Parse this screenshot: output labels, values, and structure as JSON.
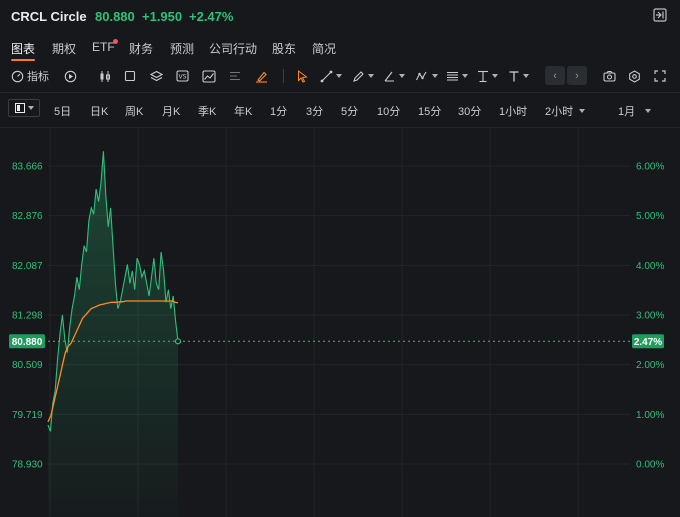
{
  "header": {
    "symbol": "CRCL Circle",
    "price": "80.880",
    "change": "+1.950",
    "change_pct": "+2.47%",
    "up_color": "#2fc07a",
    "exit_icon": "exit-fullscreen-icon"
  },
  "nav": {
    "tabs": [
      {
        "label": "图表",
        "active": true
      },
      {
        "label": "期权"
      },
      {
        "label": "ETF",
        "badge": true
      },
      {
        "label": "财务"
      },
      {
        "label": "预测"
      },
      {
        "label": "公司行动"
      },
      {
        "label": "股东"
      },
      {
        "label": "简况"
      }
    ],
    "accent": "#ff7a1a"
  },
  "toolbar": {
    "indicators_label": "指标"
  },
  "periods": {
    "items": [
      "5日",
      "日K",
      "周K",
      "月K",
      "季K",
      "年K",
      "1分",
      "3分",
      "5分",
      "10分",
      "15分",
      "30分",
      "1小时",
      "2小时",
      "1月"
    ],
    "dropdown_items": [
      "2小时",
      "1月"
    ]
  },
  "chart_data": {
    "type": "line",
    "y_left_ticks": [
      "83.666",
      "82.876",
      "82.087",
      "81.298",
      "80.509",
      "79.719",
      "78.930"
    ],
    "y_right_ticks": [
      "6.00%",
      "5.00%",
      "4.00%",
      "3.00%",
      "2.00%",
      "1.00%",
      "0.00%"
    ],
    "ylim": [
      78.93,
      83.666
    ],
    "current_price_label": "80.880",
    "current_pct_label": "2.47%",
    "price_series": [
      79.55,
      79.45,
      79.9,
      80.1,
      80.6,
      81.0,
      81.3,
      80.9,
      80.7,
      81.1,
      81.4,
      81.6,
      81.9,
      81.7,
      82.1,
      82.4,
      82.3,
      82.8,
      83.0,
      82.9,
      83.3,
      83.1,
      83.4,
      83.9,
      83.2,
      82.7,
      83.0,
      82.4,
      81.8,
      81.4,
      81.5,
      81.7,
      81.9,
      82.1,
      81.8,
      82.0,
      81.7,
      82.2,
      82.1,
      81.9,
      82.0,
      81.8,
      81.6,
      81.9,
      82.2,
      81.8,
      81.7,
      82.3,
      82.0,
      81.5,
      81.7,
      81.4,
      81.6,
      81.2,
      80.88
    ],
    "avg_series": [
      79.6,
      79.7,
      79.9,
      80.1,
      80.3,
      80.5,
      80.7,
      80.8,
      80.85,
      80.95,
      81.05,
      81.15,
      81.25,
      81.3,
      81.35,
      81.4,
      81.42,
      81.44,
      81.46,
      81.47,
      81.48,
      81.49,
      81.5,
      81.5,
      81.5,
      81.51,
      81.51,
      81.52,
      81.52,
      81.52,
      81.52,
      81.52,
      81.52,
      81.52,
      81.52,
      81.52,
      81.52,
      81.52,
      81.52,
      81.52,
      81.52,
      81.52,
      81.52,
      81.52,
      81.5,
      81.49
    ],
    "price_color": "#2fc07a",
    "avg_color": "#ff8a1f",
    "grid": true
  }
}
